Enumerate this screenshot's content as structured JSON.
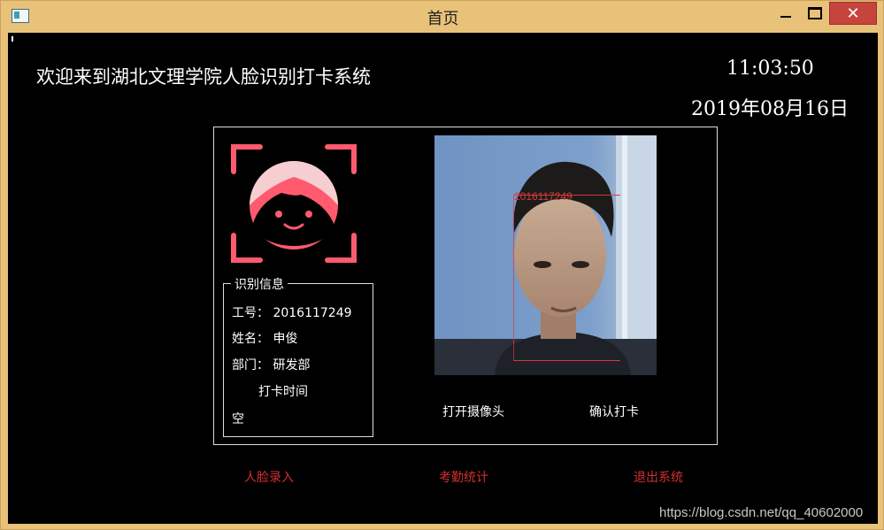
{
  "window": {
    "title": "首页",
    "close_glyph": "✕"
  },
  "header": {
    "welcome": "欢迎来到湖北文理学院人脸识别打卡系统",
    "time": "11:03:50",
    "date": "2019年08月16日"
  },
  "recognition": {
    "group_title": "识别信息",
    "employee_id": "工号： 2016117249",
    "name": "姓名： 申俊",
    "department": "部门： 研发部",
    "clock_time_label": "打卡时间",
    "clock_time_value": "空"
  },
  "camera": {
    "detected_label": "2016117249"
  },
  "buttons": {
    "open_camera": "打开摄像头",
    "confirm_clock": "确认打卡"
  },
  "nav": {
    "face_enroll": "人脸录入",
    "attendance_stats": "考勤统计",
    "exit_system": "退出系统"
  },
  "watermark": "https://blog.csdn.net/qq_40602000",
  "colors": {
    "accent_pink": "#ff5a6e",
    "nav_red": "#d43030",
    "background": "#000000"
  },
  "icons": [
    "app-window-icon",
    "face-scan-icon",
    "minimize-icon",
    "maximize-icon",
    "close-icon"
  ]
}
